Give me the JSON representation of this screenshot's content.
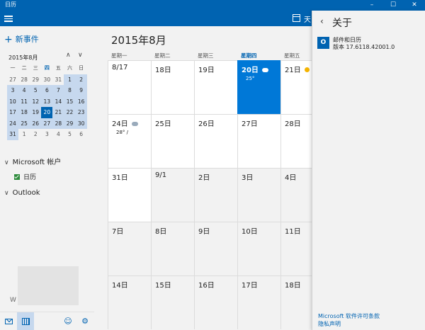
{
  "titlebar": {
    "title": "日历",
    "minimize": "–",
    "maximize": "☐",
    "close": "✕"
  },
  "toolbar": {
    "view_label": "天"
  },
  "sidebar": {
    "new_event": "新事件",
    "mini_month": "2015年8月",
    "nav_up": "∧",
    "nav_down": "∨",
    "weekdays": [
      "一",
      "二",
      "三",
      "四",
      "五",
      "六",
      "日"
    ],
    "weeks": [
      [
        "27",
        "28",
        "29",
        "30",
        "31",
        "1",
        "2"
      ],
      [
        "3",
        "4",
        "5",
        "6",
        "7",
        "8",
        "9"
      ],
      [
        "10",
        "11",
        "12",
        "13",
        "14",
        "15",
        "16"
      ],
      [
        "17",
        "18",
        "19",
        "20",
        "21",
        "22",
        "23"
      ],
      [
        "24",
        "25",
        "26",
        "27",
        "28",
        "29",
        "30"
      ],
      [
        "31",
        "1",
        "2",
        "3",
        "4",
        "5",
        "6"
      ]
    ],
    "accounts": [
      {
        "label": "Microsoft 帐户",
        "calendar": "日历"
      },
      {
        "label": "Outlook"
      }
    ],
    "partial_text": "W"
  },
  "main": {
    "month_title": "2015年8月",
    "weekdays": [
      "星期一",
      "星期二",
      "星期三",
      "星期四",
      "星期五"
    ],
    "weeks": [
      [
        "8/17",
        "18日",
        "19日",
        "20日",
        "21日"
      ],
      [
        "24日",
        "25日",
        "26日",
        "27日",
        "28日"
      ],
      [
        "31日",
        "9/1",
        "2日",
        "3日",
        "4日"
      ],
      [
        "7日",
        "8日",
        "9日",
        "10日",
        "11日"
      ],
      [
        "14日",
        "15日",
        "16日",
        "17日",
        "18日"
      ]
    ],
    "weather": {
      "today_temp": "25°",
      "w24_temp": "28° /"
    }
  },
  "about": {
    "heading": "关于",
    "app_name": "邮件和日历",
    "version": "版本 17.6118.42001.0",
    "license_link": "Microsoft 软件许可条款",
    "privacy_link": "隐私声明"
  },
  "colors": {
    "accent": "#0063b1",
    "today": "#0078d7",
    "highlight": "#c6d8ee"
  }
}
